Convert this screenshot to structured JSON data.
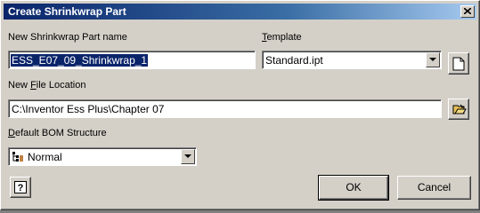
{
  "window": {
    "title": "Create Shrinkwrap Part",
    "close_icon": "close-icon"
  },
  "part_name": {
    "label": "New Shrinkwrap Part name",
    "value": "ESS_E07_09_Shrinkwrap_1"
  },
  "template": {
    "label_prefix": "",
    "label_accel": "T",
    "label_rest": "emplate",
    "value": "Standard.ipt",
    "new_file_icon": "new-document-icon"
  },
  "file_location": {
    "label_prefix": "New ",
    "label_accel": "F",
    "label_rest": "ile Location",
    "value": "C:\\Inventor Ess Plus\\Chapter 07",
    "browse_icon": "browse-folder-icon"
  },
  "bom": {
    "label_prefix": "",
    "label_accel": "D",
    "label_rest": "efault BOM Structure",
    "value": "Normal",
    "icon": "bom-normal-icon"
  },
  "buttons": {
    "help_icon": "help-icon",
    "ok": "OK",
    "cancel": "Cancel"
  },
  "colors": {
    "titlebar_start": "#0a246a",
    "titlebar_end": "#a6caf0",
    "face": "#d4d0c8",
    "selection": "#0a246a"
  }
}
